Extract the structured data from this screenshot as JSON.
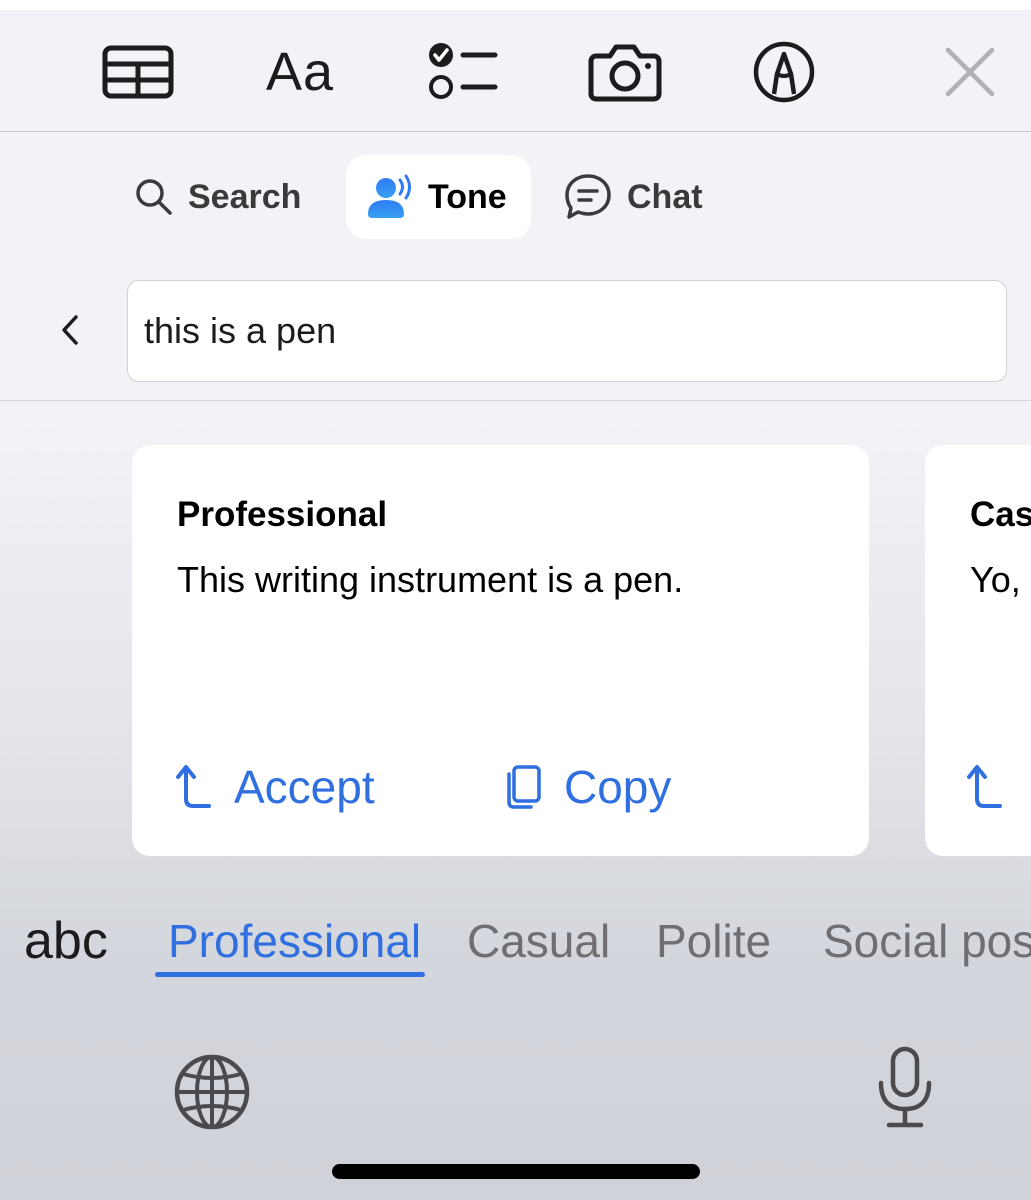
{
  "toolbar": {
    "font_label": "Aa",
    "icons": [
      "table-icon",
      "font-icon",
      "checklist-icon",
      "camera-icon",
      "markup-pen-icon",
      "close-icon"
    ]
  },
  "modes": {
    "search_label": "Search",
    "tone_label": "Tone",
    "chat_label": "Chat",
    "active": "Tone"
  },
  "input": {
    "value": "this is a pen"
  },
  "cards": [
    {
      "title": "Professional",
      "text": "This writing instrument is a pen.",
      "accept_label": "Accept",
      "copy_label": "Copy"
    },
    {
      "title": "Cas",
      "text": "Yo,"
    }
  ],
  "tone_tabs": {
    "abc_label": "abc",
    "items": [
      "Professional",
      "Casual",
      "Polite",
      "Social post"
    ],
    "active": "Professional"
  },
  "colors": {
    "accent": "#2f6fe0",
    "background": "#f2f2f7",
    "keyboard_bg": "#cfd2d8"
  }
}
